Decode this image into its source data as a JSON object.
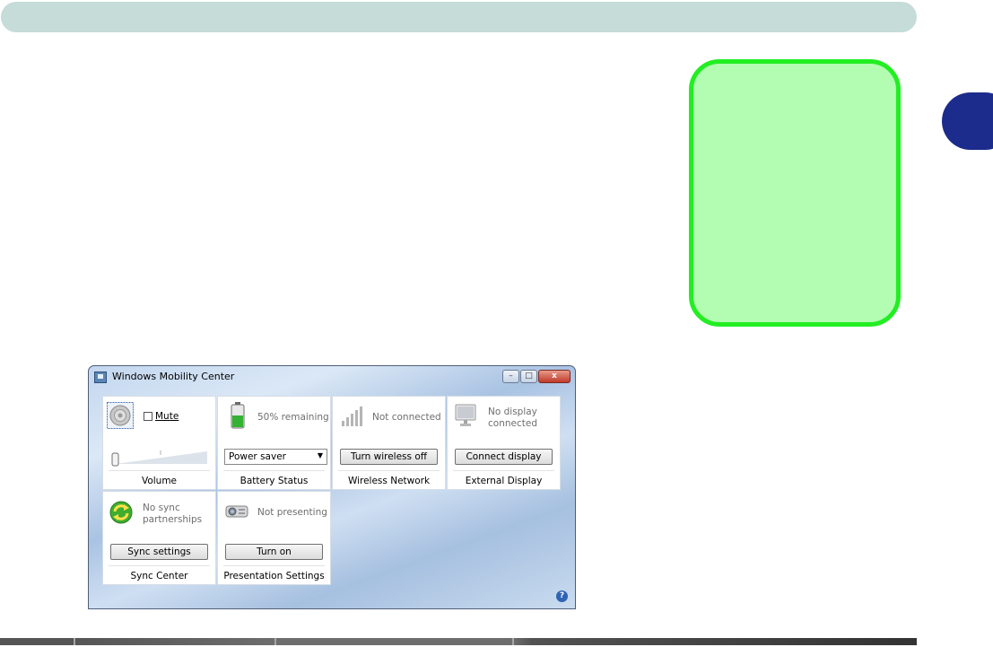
{
  "window": {
    "title": "Windows Mobility Center",
    "controls": {
      "minimize": "–",
      "maximize": "□",
      "close": "x"
    }
  },
  "tiles": {
    "volume": {
      "mute_label": "Mute",
      "caption": "Volume",
      "level": 0.0
    },
    "battery": {
      "status": "50% remaining",
      "plan": "Power saver",
      "caption": "Battery Status",
      "charge": 0.5
    },
    "wireless": {
      "status": "Not connected",
      "button": "Turn wireless off",
      "caption": "Wireless Network"
    },
    "display": {
      "status_line1": "No display",
      "status_line2": "connected",
      "button": "Connect display",
      "caption": "External Display"
    },
    "sync": {
      "status_line1": "No sync",
      "status_line2": "partnerships",
      "button": "Sync settings",
      "caption": "Sync Center"
    },
    "presentation": {
      "status": "Not presenting",
      "button": "Turn on",
      "caption": "Presentation Settings"
    }
  },
  "help": "?",
  "colors": {
    "callout_fill": "#b3fdb3",
    "callout_border": "#22ee22",
    "chapter_tab": "#1c2c8c",
    "header_bar": "#c5dcd9"
  }
}
